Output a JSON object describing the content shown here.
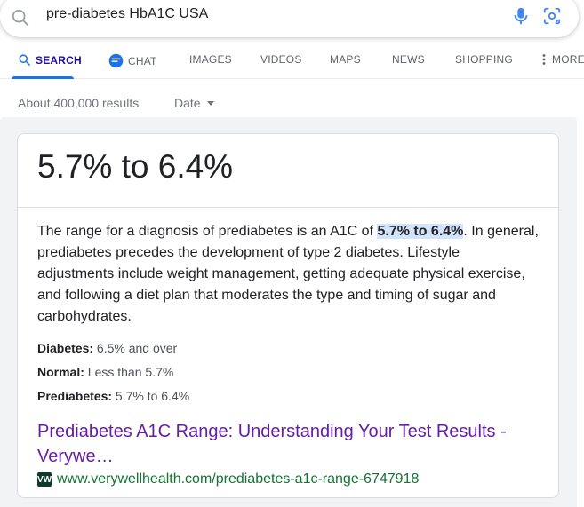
{
  "search": {
    "query": "pre-diabetes HbA1C USA"
  },
  "tabs": [
    {
      "label": "SEARCH",
      "active": true,
      "icon": "search-icon"
    },
    {
      "label": "CHAT",
      "active": false,
      "icon": "chat-icon"
    },
    {
      "label": "IMAGES",
      "active": false
    },
    {
      "label": "VIDEOS",
      "active": false
    },
    {
      "label": "MAPS",
      "active": false
    },
    {
      "label": "NEWS",
      "active": false
    },
    {
      "label": "SHOPPING",
      "active": false
    },
    {
      "label": "MORE",
      "active": false,
      "icon": "more-vertical-icon"
    }
  ],
  "tools": {
    "result_count": "About 400,000 results",
    "date_filter": "Date"
  },
  "featured": {
    "answer": "5.7% to 6.4%",
    "snippet_before": "The range for a diagnosis of prediabetes is an A1C of ",
    "snippet_highlight": "5.7% to 6.4%",
    "snippet_after": ". In general, prediabetes precedes the development of type 2 diabetes. Lifestyle adjustments include weight management, getting adequate physical exercise, and following a diet plan that moderates the type and timing of sugar and carbohydrates.",
    "facts": [
      {
        "key": "Diabetes:",
        "value": " 6.5% and over"
      },
      {
        "key": "Normal:",
        "value": " Less than 5.7%"
      },
      {
        "key": "Prediabetes:",
        "value": " 5.7% to 6.4%"
      }
    ],
    "result_title": "Prediabetes A1C Range: Understanding Your Test Results - Verywe…",
    "result_url": "www.verywellhealth.com/prediabetes-a1c-range-6747918",
    "favicon_text": "VW"
  },
  "colors": {
    "link_visited": "#681da8",
    "url_green": "#137333",
    "highlight": "#d2e3fc",
    "active_tab": "#1a73e8"
  }
}
